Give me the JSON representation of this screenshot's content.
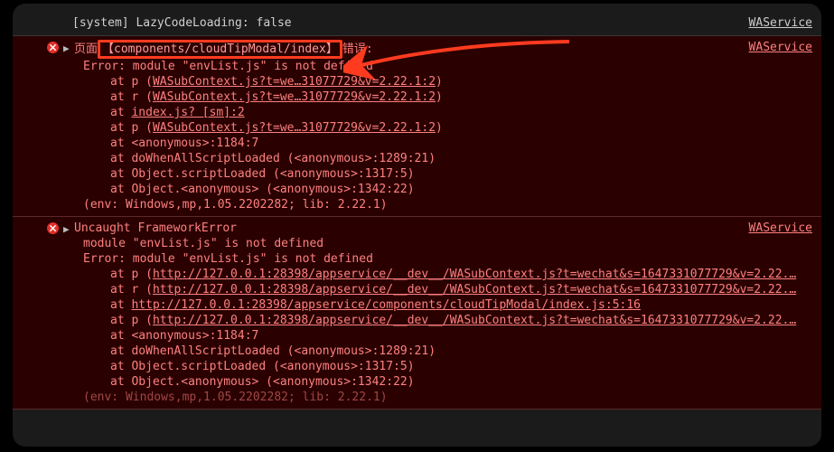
{
  "top_cut": "____________________________________________",
  "system_line": "[system] LazyCodeLoading: false",
  "right_link": "WAService",
  "error1": {
    "prefix": "页面",
    "highlight": "【components/cloudTipModal/index】",
    "suffix": "错误:",
    "msg": "Error: module \"envList.js\" is not defined",
    "stack": [
      {
        "at": "at p (",
        "link": "WASubContext.js?t=we…31077729&v=2.22.1:2",
        "tail": ")"
      },
      {
        "at": "at r (",
        "link": "WASubContext.js?t=we…31077729&v=2.22.1:2",
        "tail": ")"
      },
      {
        "at": "at ",
        "link": "index.js? [sm]:2",
        "tail": ""
      },
      {
        "at": "at p (",
        "link": "WASubContext.js?t=we…31077729&v=2.22.1:2",
        "tail": ")"
      },
      {
        "at": "at <anonymous>:1184:7",
        "link": "",
        "tail": ""
      },
      {
        "at": "at doWhenAllScriptLoaded (<anonymous>:1289:21)",
        "link": "",
        "tail": ""
      },
      {
        "at": "at Object.scriptLoaded (<anonymous>:1317:5)",
        "link": "",
        "tail": ""
      },
      {
        "at": "at Object.<anonymous> (<anonymous>:1342:22)",
        "link": "",
        "tail": ""
      }
    ],
    "env": "(env: Windows,mp,1.05.2202282; lib: 2.22.1)"
  },
  "error2": {
    "title": "Uncaught FrameworkError",
    "line1": "module \"envList.js\" is not defined",
    "line2": "Error: module \"envList.js\" is not defined",
    "stack": [
      {
        "at": "at p (",
        "link": "http://127.0.0.1:28398/appservice/__dev__/WASubContext.js?t=wechat&s=1647331077729&v=2.22.…",
        "tail": ""
      },
      {
        "at": "at r (",
        "link": "http://127.0.0.1:28398/appservice/__dev__/WASubContext.js?t=wechat&s=1647331077729&v=2.22.…",
        "tail": ""
      },
      {
        "at": "at ",
        "link": "http://127.0.0.1:28398/appservice/components/cloudTipModal/index.js:5:16",
        "tail": ""
      },
      {
        "at": "at p (",
        "link": "http://127.0.0.1:28398/appservice/__dev__/WASubContext.js?t=wechat&s=1647331077729&v=2.22.…",
        "tail": ""
      },
      {
        "at": "at <anonymous>:1184:7",
        "link": "",
        "tail": ""
      },
      {
        "at": "at doWhenAllScriptLoaded (<anonymous>:1289:21)",
        "link": "",
        "tail": ""
      },
      {
        "at": "at Object.scriptLoaded (<anonymous>:1317:5)",
        "link": "",
        "tail": ""
      },
      {
        "at": "at Object.<anonymous> (<anonymous>:1342:22)",
        "link": "",
        "tail": ""
      }
    ],
    "env": "(env: Windows,mp,1.05.2202282; lib: 2.22.1)"
  }
}
